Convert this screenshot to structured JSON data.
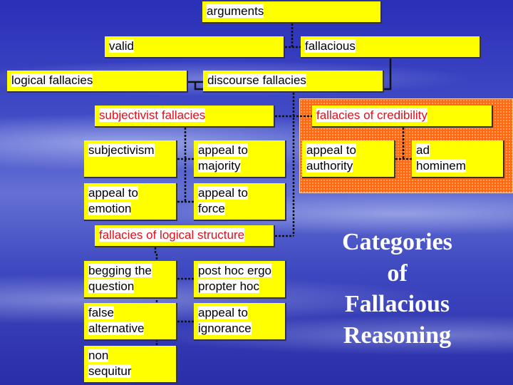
{
  "title": {
    "line1": "Categories",
    "line2": "of",
    "line3": "Fallacious",
    "line4": "Reasoning"
  },
  "nodes": {
    "arguments": "arguments",
    "valid": "valid",
    "fallacious": "fallacious",
    "logical": "logical fallacies",
    "discourse": "discourse fallacies",
    "subjectivist": "subjectivist fallacies",
    "credibility": "fallacies of credibility",
    "subjectivism": "subjectivism",
    "majority_1": "appeal to",
    "majority_2": "majority",
    "authority_1": "appeal to",
    "authority_2": "authority",
    "hominem_1": "ad",
    "hominem_2": "hominem",
    "emotion_1": "appeal to",
    "emotion_2": "emotion",
    "force_1": "appeal to",
    "force_2": "force",
    "structure": "fallacies of logical structure",
    "begging_1": "begging the",
    "begging_2": "question",
    "posthoc_1": "post hoc ergo",
    "posthoc_2": "propter hoc",
    "false_1": "false",
    "false_2": "alternative",
    "ignorance_1": "appeal to",
    "ignorance_2": "ignorance",
    "non_1": "non",
    "non_2": "sequitur"
  },
  "colors": {
    "box": "#ffff00",
    "highlight_text": "#e0101a",
    "highlight_area": "#ff6a10",
    "background": "#3e48c0"
  }
}
